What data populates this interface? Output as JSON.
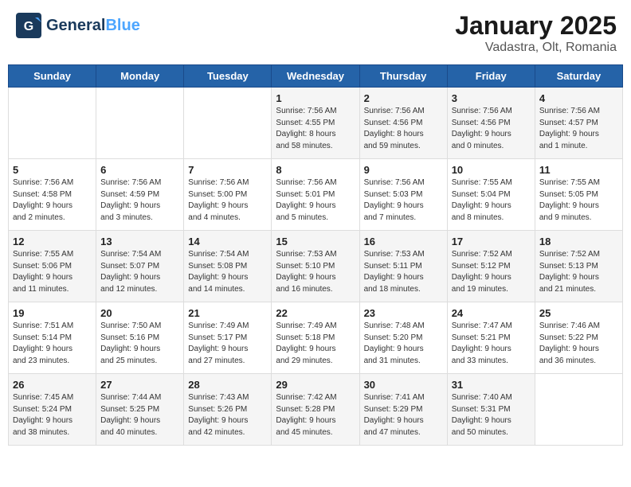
{
  "header": {
    "logo_general": "General",
    "logo_blue": "Blue",
    "month": "January 2025",
    "location": "Vadastra, Olt, Romania"
  },
  "days_of_week": [
    "Sunday",
    "Monday",
    "Tuesday",
    "Wednesday",
    "Thursday",
    "Friday",
    "Saturday"
  ],
  "weeks": [
    [
      {
        "day": "",
        "info": ""
      },
      {
        "day": "",
        "info": ""
      },
      {
        "day": "",
        "info": ""
      },
      {
        "day": "1",
        "info": "Sunrise: 7:56 AM\nSunset: 4:55 PM\nDaylight: 8 hours\nand 58 minutes."
      },
      {
        "day": "2",
        "info": "Sunrise: 7:56 AM\nSunset: 4:56 PM\nDaylight: 8 hours\nand 59 minutes."
      },
      {
        "day": "3",
        "info": "Sunrise: 7:56 AM\nSunset: 4:56 PM\nDaylight: 9 hours\nand 0 minutes."
      },
      {
        "day": "4",
        "info": "Sunrise: 7:56 AM\nSunset: 4:57 PM\nDaylight: 9 hours\nand 1 minute."
      }
    ],
    [
      {
        "day": "5",
        "info": "Sunrise: 7:56 AM\nSunset: 4:58 PM\nDaylight: 9 hours\nand 2 minutes."
      },
      {
        "day": "6",
        "info": "Sunrise: 7:56 AM\nSunset: 4:59 PM\nDaylight: 9 hours\nand 3 minutes."
      },
      {
        "day": "7",
        "info": "Sunrise: 7:56 AM\nSunset: 5:00 PM\nDaylight: 9 hours\nand 4 minutes."
      },
      {
        "day": "8",
        "info": "Sunrise: 7:56 AM\nSunset: 5:01 PM\nDaylight: 9 hours\nand 5 minutes."
      },
      {
        "day": "9",
        "info": "Sunrise: 7:56 AM\nSunset: 5:03 PM\nDaylight: 9 hours\nand 7 minutes."
      },
      {
        "day": "10",
        "info": "Sunrise: 7:55 AM\nSunset: 5:04 PM\nDaylight: 9 hours\nand 8 minutes."
      },
      {
        "day": "11",
        "info": "Sunrise: 7:55 AM\nSunset: 5:05 PM\nDaylight: 9 hours\nand 9 minutes."
      }
    ],
    [
      {
        "day": "12",
        "info": "Sunrise: 7:55 AM\nSunset: 5:06 PM\nDaylight: 9 hours\nand 11 minutes."
      },
      {
        "day": "13",
        "info": "Sunrise: 7:54 AM\nSunset: 5:07 PM\nDaylight: 9 hours\nand 12 minutes."
      },
      {
        "day": "14",
        "info": "Sunrise: 7:54 AM\nSunset: 5:08 PM\nDaylight: 9 hours\nand 14 minutes."
      },
      {
        "day": "15",
        "info": "Sunrise: 7:53 AM\nSunset: 5:10 PM\nDaylight: 9 hours\nand 16 minutes."
      },
      {
        "day": "16",
        "info": "Sunrise: 7:53 AM\nSunset: 5:11 PM\nDaylight: 9 hours\nand 18 minutes."
      },
      {
        "day": "17",
        "info": "Sunrise: 7:52 AM\nSunset: 5:12 PM\nDaylight: 9 hours\nand 19 minutes."
      },
      {
        "day": "18",
        "info": "Sunrise: 7:52 AM\nSunset: 5:13 PM\nDaylight: 9 hours\nand 21 minutes."
      }
    ],
    [
      {
        "day": "19",
        "info": "Sunrise: 7:51 AM\nSunset: 5:14 PM\nDaylight: 9 hours\nand 23 minutes."
      },
      {
        "day": "20",
        "info": "Sunrise: 7:50 AM\nSunset: 5:16 PM\nDaylight: 9 hours\nand 25 minutes."
      },
      {
        "day": "21",
        "info": "Sunrise: 7:49 AM\nSunset: 5:17 PM\nDaylight: 9 hours\nand 27 minutes."
      },
      {
        "day": "22",
        "info": "Sunrise: 7:49 AM\nSunset: 5:18 PM\nDaylight: 9 hours\nand 29 minutes."
      },
      {
        "day": "23",
        "info": "Sunrise: 7:48 AM\nSunset: 5:20 PM\nDaylight: 9 hours\nand 31 minutes."
      },
      {
        "day": "24",
        "info": "Sunrise: 7:47 AM\nSunset: 5:21 PM\nDaylight: 9 hours\nand 33 minutes."
      },
      {
        "day": "25",
        "info": "Sunrise: 7:46 AM\nSunset: 5:22 PM\nDaylight: 9 hours\nand 36 minutes."
      }
    ],
    [
      {
        "day": "26",
        "info": "Sunrise: 7:45 AM\nSunset: 5:24 PM\nDaylight: 9 hours\nand 38 minutes."
      },
      {
        "day": "27",
        "info": "Sunrise: 7:44 AM\nSunset: 5:25 PM\nDaylight: 9 hours\nand 40 minutes."
      },
      {
        "day": "28",
        "info": "Sunrise: 7:43 AM\nSunset: 5:26 PM\nDaylight: 9 hours\nand 42 minutes."
      },
      {
        "day": "29",
        "info": "Sunrise: 7:42 AM\nSunset: 5:28 PM\nDaylight: 9 hours\nand 45 minutes."
      },
      {
        "day": "30",
        "info": "Sunrise: 7:41 AM\nSunset: 5:29 PM\nDaylight: 9 hours\nand 47 minutes."
      },
      {
        "day": "31",
        "info": "Sunrise: 7:40 AM\nSunset: 5:31 PM\nDaylight: 9 hours\nand 50 minutes."
      },
      {
        "day": "",
        "info": ""
      }
    ]
  ]
}
